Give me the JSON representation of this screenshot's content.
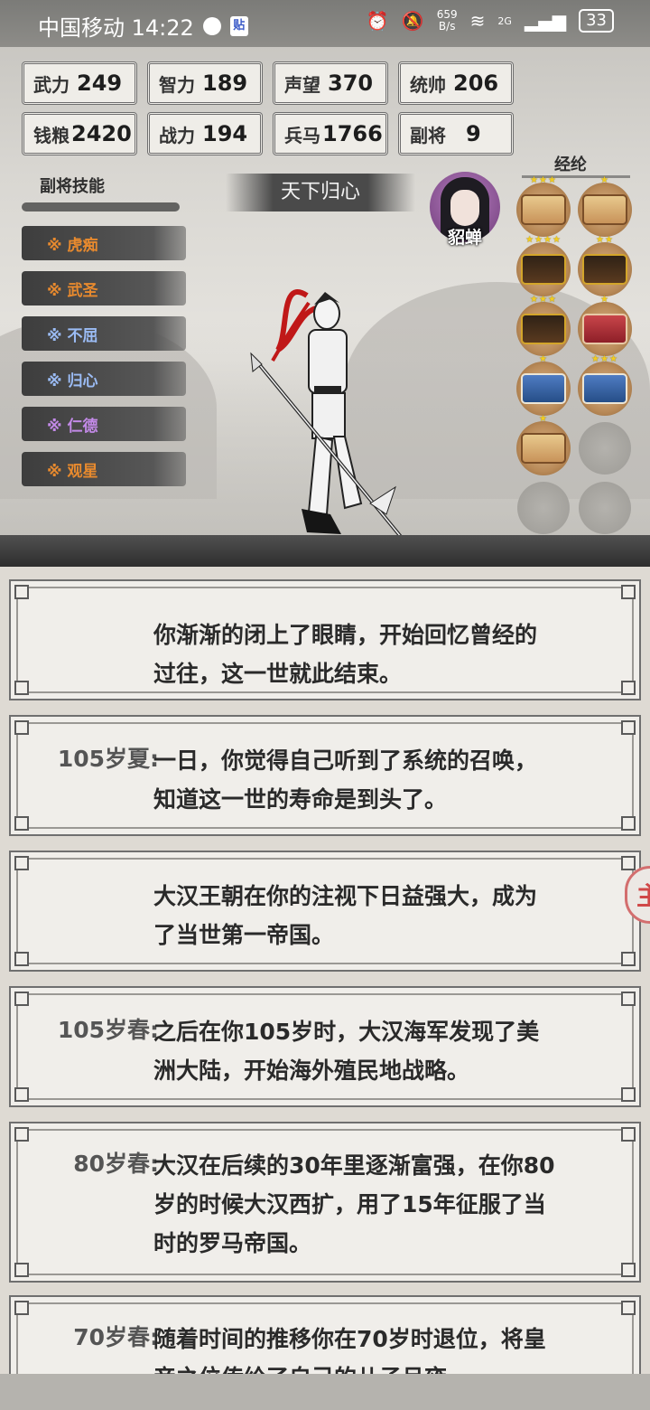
{
  "status_bar": {
    "carrier_time": "中国移动 14:22",
    "badge": "贴",
    "net_speed_top": "659",
    "net_speed_unit": "B/s",
    "signal": "2G",
    "battery": "33"
  },
  "stats": [
    {
      "label": "武力",
      "value": "249"
    },
    {
      "label": "智力",
      "value": "189"
    },
    {
      "label": "声望",
      "value": "370"
    },
    {
      "label": "统帅",
      "value": "206"
    },
    {
      "label": "钱粮",
      "value": "2420"
    },
    {
      "label": "战力",
      "value": "194"
    },
    {
      "label": "兵马",
      "value": "1766"
    },
    {
      "label": "副将",
      "value": "9"
    }
  ],
  "skills": {
    "title": "副将技能",
    "items": [
      {
        "label": "※ 虎痴",
        "color": "#e88a2e"
      },
      {
        "label": "※ 武圣",
        "color": "#e88a2e"
      },
      {
        "label": "※ 不屈",
        "color": "#9bbcf5"
      },
      {
        "label": "※ 归心",
        "color": "#9bbcf5"
      },
      {
        "label": "※ 仁德",
        "color": "#c38ae8"
      },
      {
        "label": "※ 观星",
        "color": "#e88a2e"
      }
    ]
  },
  "banner": "天下归心",
  "portrait_name": "貂蝉",
  "jinglun": {
    "title": "经纶",
    "books": [
      {
        "kind": "scroll",
        "stars": "★★★"
      },
      {
        "kind": "scroll",
        "stars": "★"
      },
      {
        "kind": "dark",
        "stars": "★★★★"
      },
      {
        "kind": "dark",
        "stars": "★★"
      },
      {
        "kind": "dark",
        "stars": "★★★"
      },
      {
        "kind": "red",
        "stars": "★"
      },
      {
        "kind": "blue",
        "stars": "★"
      },
      {
        "kind": "blue",
        "stars": "★★★"
      },
      {
        "kind": "scroll",
        "stars": "★"
      },
      {
        "kind": "empty",
        "stars": ""
      },
      {
        "kind": "empty",
        "stars": ""
      },
      {
        "kind": "empty",
        "stars": ""
      }
    ]
  },
  "events": [
    {
      "time": "",
      "lines": [
        "你渐渐的闭上了眼睛，开始回忆曾经的",
        "过往，这一世就此结束。"
      ]
    },
    {
      "time": "105岁夏:",
      "lines": [
        "一日，你觉得自己听到了系统的召唤，",
        "知道这一世的寿命是到头了。"
      ]
    },
    {
      "time": "",
      "lines": [
        "大汉王朝在你的注视下日益强大，成为",
        "了当世第一帝国。"
      ]
    },
    {
      "time": "105岁春:",
      "lines": [
        "之后在你105岁时，大汉海军发现了美",
        "洲大陆，开始海外殖民地战略。"
      ]
    },
    {
      "time": "80岁春:",
      "lines": [
        "大汉在后续的30年里逐渐富强，在你80",
        "岁的时候大汉西扩，用了15年征服了当",
        "时的罗马帝国。"
      ]
    },
    {
      "time": "70岁春:",
      "lines": [
        "随着时间的推移你在70岁时退位，将皇",
        "帝之位传给了自己的儿子吕雍。"
      ]
    }
  ],
  "float_button": "主"
}
